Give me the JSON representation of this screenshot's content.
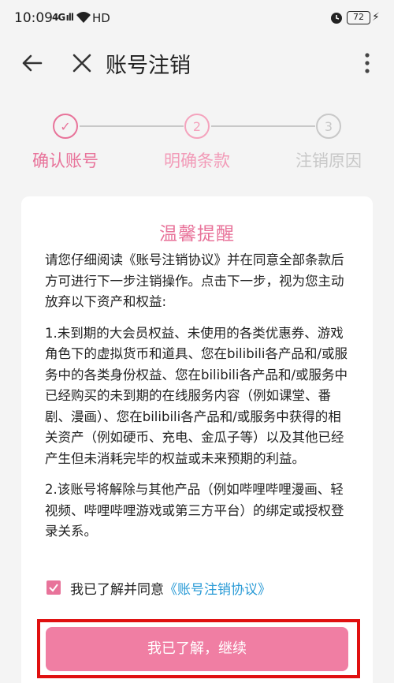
{
  "status_bar": {
    "time": "10:09",
    "signal": "4G ıll",
    "network": "HD",
    "battery": "72"
  },
  "toolbar": {
    "title": "账号注销",
    "back_icon": "arrow-left-icon",
    "close_icon": "close-icon",
    "more_icon": "more-vertical-icon"
  },
  "stepper": {
    "steps": [
      {
        "label": "确认账号",
        "marker": "✓",
        "state": "done"
      },
      {
        "label": "明确条款",
        "marker": "2",
        "state": "active"
      },
      {
        "label": "注销原因",
        "marker": "3",
        "state": "pending"
      }
    ]
  },
  "card": {
    "title": "温馨提醒",
    "paragraphs": [
      "请您仔细阅读《账号注销协议》并在同意全部条款后方可进行下一步注销操作。点击下一步，视为您主动放弃以下资产和权益:",
      "1.未到期的大会员权益、未使用的各类优惠券、游戏角色下的虚拟货币和道具、您在bilibili各产品和/或服务中的各类身份权益、您在bilibili各产品和/或服务中已经购买的未到期的在线服务内容（例如课堂、番剧、漫画）、您在bilibili各产品和/或服务中获得的相关资产（例如硬币、充电、金瓜子等）以及其他已经产生但未消耗完毕的权益或未来预期的利益。",
      "2.该账号将解除与其他产品（例如哔哩哔哩漫画、轻视频、哔哩哔哩游戏或第三方平台）的绑定或授权登录关系。"
    ]
  },
  "agreement": {
    "checked": true,
    "text": "我已了解并同意",
    "link": "《账号注销协议》"
  },
  "continue_button": {
    "label": "我已了解，继续"
  },
  "colors": {
    "accent": "#e8739a",
    "button": "#f07ea3",
    "link": "#2b9bd6",
    "highlight_frame": "#e01010",
    "pending": "#c8c8c8"
  }
}
